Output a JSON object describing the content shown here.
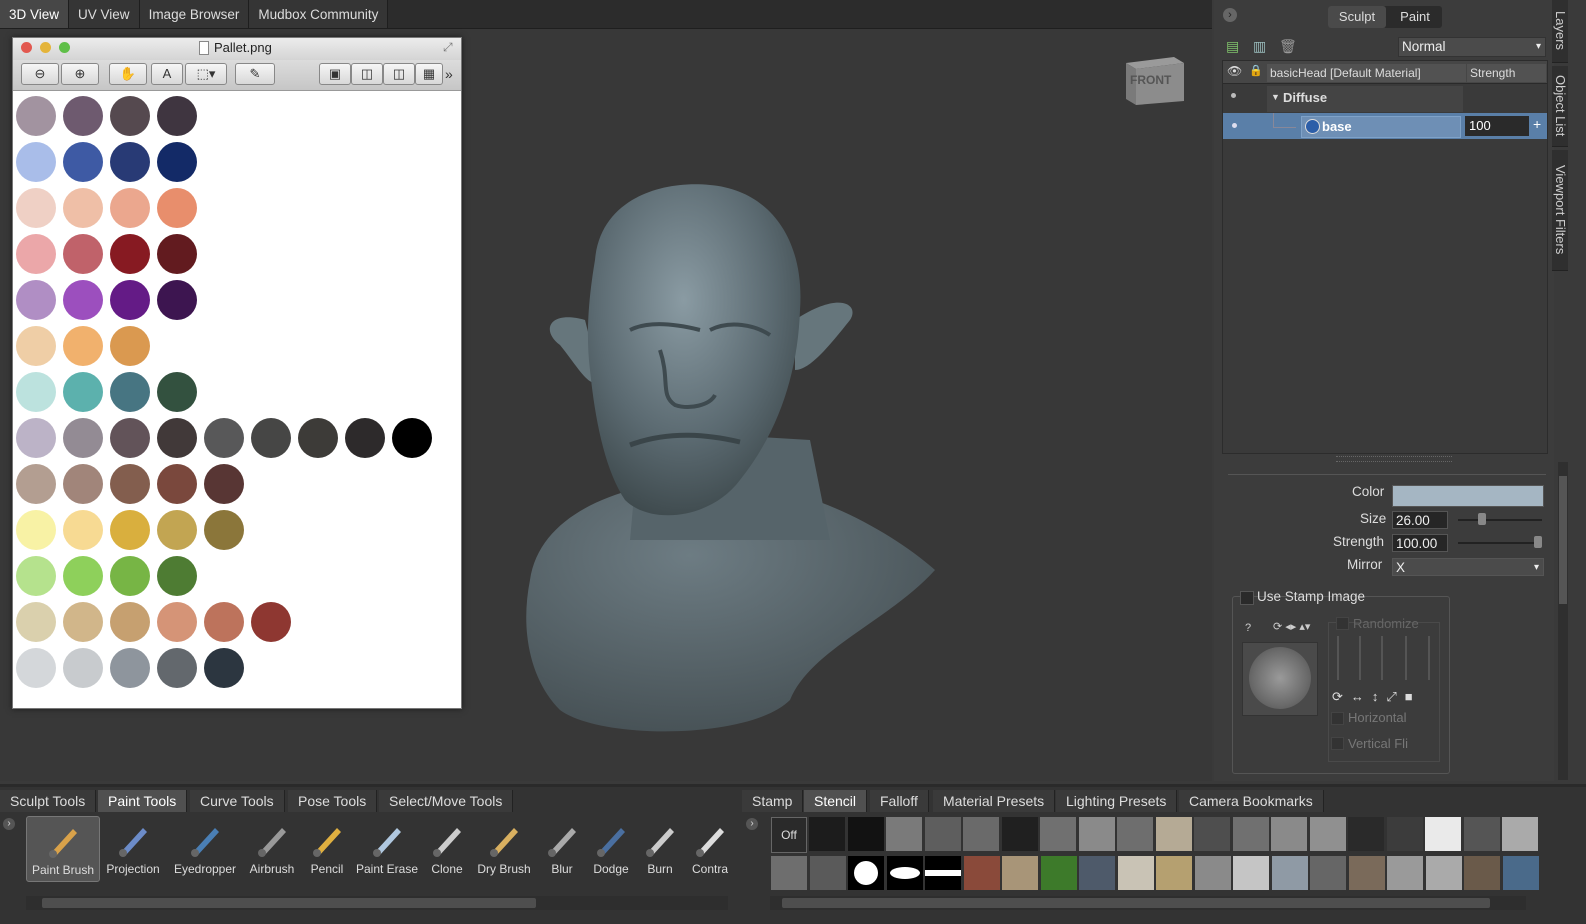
{
  "top_tabs": [
    "3D View",
    "UV View",
    "Image Browser",
    "Mudbox Community"
  ],
  "viewcube_label": "FRONT",
  "image_browser": {
    "title": "Pallet.png",
    "swatch_rows": [
      [
        "#a293a0",
        "#6e5a6f",
        "#55494f",
        "#3f3540"
      ],
      [
        "#a9bde9",
        "#3e5aa4",
        "#283a75",
        "#132a67"
      ],
      [
        "#efd0c5",
        "#efbfa7",
        "#eba78e",
        "#e88e6c"
      ],
      [
        "#eba7a9",
        "#c0626a",
        "#871a22",
        "#621b1f"
      ],
      [
        "#b08ec4",
        "#9c4fbe",
        "#641b86",
        "#3d1550"
      ],
      [
        "#efcea6",
        "#f1b16d",
        "#da9950"
      ],
      [
        "#bce2de",
        "#5cb1ad",
        "#477582",
        "#33513f"
      ],
      [
        "#bcb3c7",
        "#938b94",
        "#625359",
        "#413939",
        "#585859",
        "#464645",
        "#3d3b38",
        "#2d2a2b",
        "#000000"
      ],
      [
        "#b39e91",
        "#a1857a",
        "#835e4e",
        "#7a483d",
        "#583634"
      ],
      [
        "#f8f2a5",
        "#f7da93",
        "#d9af3e",
        "#c2a552",
        "#8b763a"
      ],
      [
        "#b5e28d",
        "#8ed05b",
        "#77b545",
        "#4e7c33"
      ],
      [
        "#dad0ad",
        "#d1b68a",
        "#c6a070",
        "#d59477",
        "#bd735c",
        "#8e3731"
      ],
      [
        "#d4d7da",
        "#c8cbce",
        "#8e959d",
        "#63686d",
        "#2c3640"
      ]
    ]
  },
  "right_panel": {
    "mode_tabs": [
      "Sculpt",
      "Paint"
    ],
    "blend_mode": "Normal",
    "layer_header": {
      "name": "basicHead [Default Material]",
      "strength": "Strength"
    },
    "channel": "Diffuse",
    "layer": {
      "name": "base",
      "value": "100"
    },
    "properties": {
      "color_label": "Color",
      "size_label": "Size",
      "size_value": "26.00",
      "strength_label": "Strength",
      "strength_value": "100.00",
      "mirror_label": "Mirror",
      "mirror_value": "X",
      "use_stamp_label": "Use Stamp Image",
      "randomize_label": "Randomize",
      "horizontal_label": "Horizontal",
      "vertical_label": "Vertical Fli"
    }
  },
  "side_tabs": [
    "Layers",
    "Object List",
    "Viewport Filters"
  ],
  "tool_tabs": [
    "Sculpt Tools",
    "Paint Tools",
    "Curve Tools",
    "Pose Tools",
    "Select/Move Tools"
  ],
  "tools": [
    "Paint Brush",
    "Projection",
    "Eyedropper",
    "Airbrush",
    "Pencil",
    "Paint Erase",
    "Clone",
    "Dry Brush",
    "Blur",
    "Dodge",
    "Burn",
    "Contra"
  ],
  "tray_tabs": [
    "Stamp",
    "Stencil",
    "Falloff",
    "Material Presets",
    "Lighting Presets",
    "Camera Bookmarks"
  ],
  "stencil_off_label": "Off",
  "colors": {
    "accent_select": "#5a7fa8",
    "panel_bg": "#3c3c3c",
    "viewport_bg": "#383838"
  }
}
